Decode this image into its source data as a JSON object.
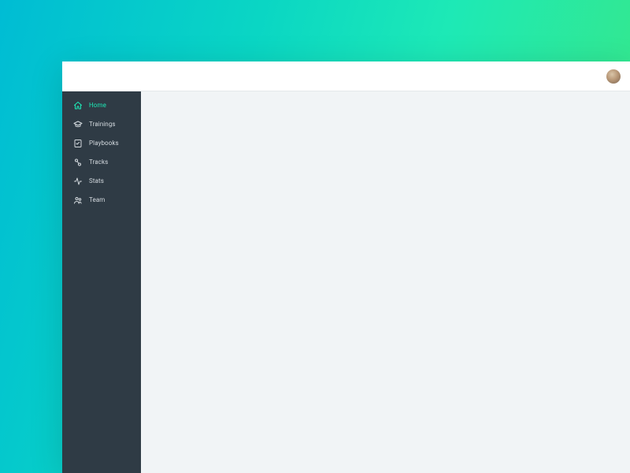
{
  "colors": {
    "accent": "#1de9b6",
    "sidebar_bg": "#2f3b45",
    "content_bg": "#f1f4f6"
  },
  "sidebar": {
    "items": [
      {
        "label": "Home",
        "icon": "home-icon",
        "active": true
      },
      {
        "label": "Trainings",
        "icon": "grad-cap-icon",
        "active": false
      },
      {
        "label": "Playbooks",
        "icon": "checklist-icon",
        "active": false
      },
      {
        "label": "Tracks",
        "icon": "tracks-icon",
        "active": false
      },
      {
        "label": "Stats",
        "icon": "activity-icon",
        "active": false
      },
      {
        "label": "Team",
        "icon": "team-icon",
        "active": false
      }
    ]
  }
}
